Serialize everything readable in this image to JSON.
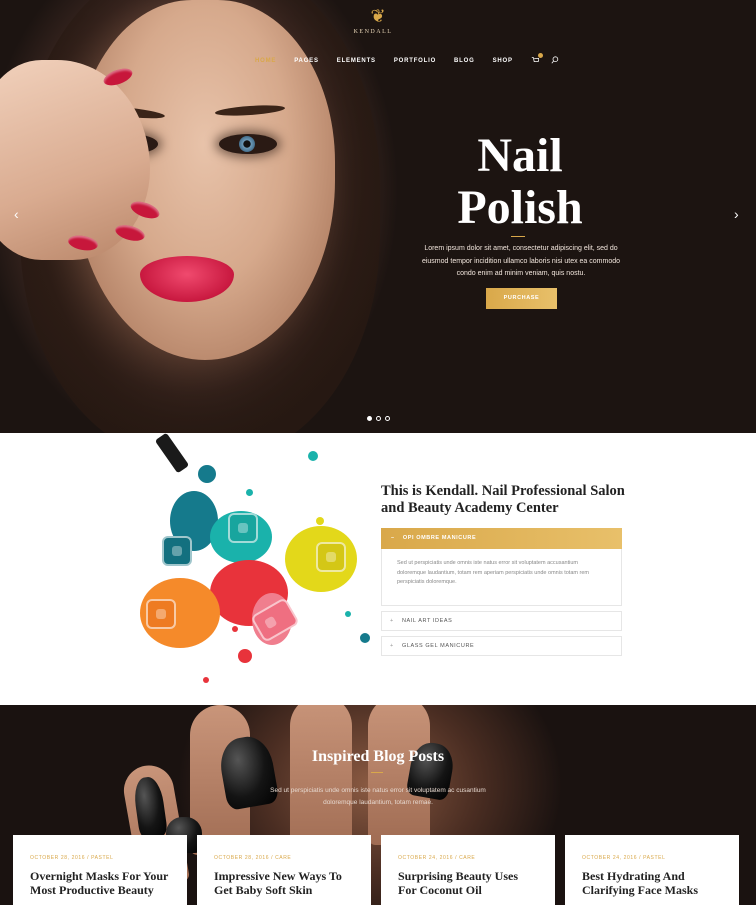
{
  "brand": {
    "name": "KENDALL",
    "logo_icon": "leaf-icon",
    "accent": "#d9a84a"
  },
  "nav": {
    "items": [
      {
        "label": "HOME",
        "active": true
      },
      {
        "label": "PAGES"
      },
      {
        "label": "ELEMENTS"
      },
      {
        "label": "PORTFOLIO"
      },
      {
        "label": "BLOG"
      },
      {
        "label": "SHOP"
      }
    ],
    "cart_icon": "cart-icon",
    "search_icon": "search-icon"
  },
  "hero": {
    "title_line1": "Nail",
    "title_line2": "Polish",
    "text": "Lorem ipsum dolor sit amet, consectetur adipiscing elit, sed do eiusmod tempor incidition ullamco laboris nisi utex ea commodo condo enim ad minim veniam, quis nostu.",
    "button": "PURCHASE",
    "prev": "‹",
    "next": "›",
    "slides": 3,
    "active_slide": 1
  },
  "about": {
    "title": "This is Kendall. Nail Professional Salon and Beauty Academy Center",
    "accordion": [
      {
        "sign": "–",
        "label": "OPI OMBRE MANICURE",
        "open": true,
        "body": "Sed ut perspiciatis unde omnis iste natus error sit voluptatem accusantium doloremque laudantium, totam rem aperiam perspiciatis unde omnis totam rem perspiciatis doloremque."
      },
      {
        "sign": "+",
        "label": "NAIL ART IDEAS",
        "open": false
      },
      {
        "sign": "+",
        "label": "GLASS GEL MANICURE",
        "open": false
      }
    ]
  },
  "blog": {
    "title": "Inspired Blog Posts",
    "text": "Sed ut perspiciatis unde omnis iste natus error sit voluptatem ac cusantium doloremque laudantium, totam remae.",
    "posts": [
      {
        "date": "OCTOBER 28, 2016",
        "category": "PASTEL",
        "title": "Overnight Masks For Your Most Productive Beauty"
      },
      {
        "date": "OCTOBER 28, 2016",
        "category": "CARE",
        "title": "Impressive New Ways To Get Baby Soft Skin"
      },
      {
        "date": "OCTOBER 24, 2016",
        "category": "CARE",
        "title": "Surprising Beauty Uses For Coconut Oil"
      },
      {
        "date": "OCTOBER 24, 2016",
        "category": "PASTEL",
        "title": "Best Hydrating And Clarifying Face Masks"
      }
    ]
  }
}
